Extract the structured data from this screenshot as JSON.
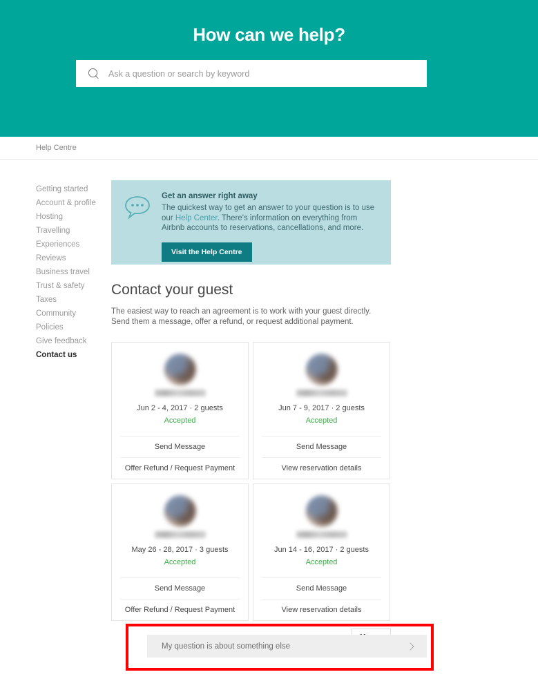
{
  "hero": {
    "title": "How can we help?",
    "search_placeholder": "Ask a question or search by keyword",
    "search_value": "",
    "search_icon": "search-icon",
    "background_color": "#00a699"
  },
  "breadcrumb": {
    "items": [
      "Help Centre"
    ]
  },
  "sidebar": {
    "items": [
      {
        "label": "Getting started",
        "active": false
      },
      {
        "label": "Account & profile",
        "active": false
      },
      {
        "label": "Hosting",
        "active": false
      },
      {
        "label": "Travelling",
        "active": false
      },
      {
        "label": "Experiences",
        "active": false
      },
      {
        "label": "Reviews",
        "active": false
      },
      {
        "label": "Business travel",
        "active": false
      },
      {
        "label": "Trust & safety",
        "active": false
      },
      {
        "label": "Taxes",
        "active": false
      },
      {
        "label": "Community",
        "active": false
      },
      {
        "label": "Policies",
        "active": false
      },
      {
        "label": "Give feedback",
        "active": false
      },
      {
        "label": "Contact us",
        "active": true
      }
    ]
  },
  "info_banner": {
    "icon": "speech-bubble-icon",
    "title": "Get an answer right away",
    "body_part1": "The quickest way to get an answer to your question is to use our ",
    "link_text": "Help Center",
    "body_part2": ". There's information on everything from Airbnb accounts to reservations, cancellations, and more.",
    "button_label": "Visit the Help Centre",
    "background_color": "#b9dde0",
    "button_color": "#0f7b82"
  },
  "section": {
    "title": "Contact your guest",
    "description": "The easiest way to reach an agreement is to work with your guest directly. Send them a message, offer a refund, or request additional payment."
  },
  "cards": [
    {
      "guest_name": "",
      "dates": "Jun 2 - 4, 2017 · 2 guests",
      "status": "Accepted",
      "status_color": "#3fae4a",
      "action_primary": "Send Message",
      "action_secondary": "Offer Refund / Request Payment"
    },
    {
      "guest_name": "",
      "dates": "Jun 7 - 9, 2017 · 2 guests",
      "status": "Accepted",
      "status_color": "#3fae4a",
      "action_primary": "Send Message",
      "action_secondary": "View reservation details"
    },
    {
      "guest_name": "",
      "dates": "May 26 - 28, 2017 · 3 guests",
      "status": "Accepted",
      "status_color": "#3fae4a",
      "action_primary": "Send Message",
      "action_secondary": "Offer Refund / Request Payment"
    },
    {
      "guest_name": "",
      "dates": "Jun 14 - 16, 2017 · 2 guests",
      "status": "Accepted",
      "status_color": "#3fae4a",
      "action_primary": "Send Message",
      "action_secondary": "View reservation details"
    }
  ],
  "more_button": {
    "label": "More",
    "icon": "caret-right-icon"
  },
  "something_else": {
    "label": "My question is about something else",
    "icon": "chevron-right-icon",
    "highlight_color": "#ff0000"
  }
}
